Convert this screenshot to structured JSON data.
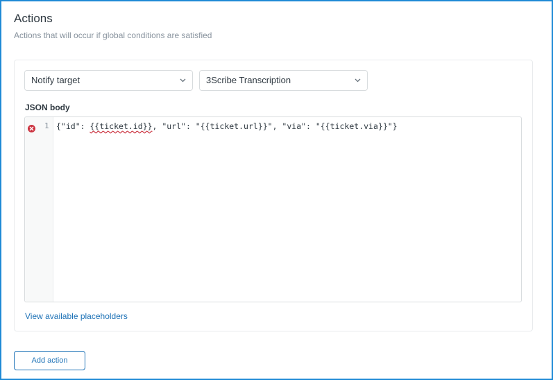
{
  "section": {
    "title": "Actions",
    "subtitle": "Actions that will occur if global conditions are satisfied"
  },
  "action": {
    "type_select": {
      "value": "Notify target",
      "icon": "chevron-down-icon"
    },
    "target_select": {
      "value": "3Scribe Transcription",
      "icon": "chevron-down-icon"
    },
    "json_body": {
      "label": "JSON body",
      "lines": [
        {
          "number": "1",
          "has_error": true,
          "before": "{\"id\": ",
          "error_token": "{{ticket.id}}",
          "after": ", \"url\": \"{{ticket.url}}\", \"via\": \"{{ticket.via}}\"}"
        }
      ],
      "error_icon": "error-circle-icon",
      "error_color": "#cc3340"
    },
    "placeholders_link": "View available placeholders"
  },
  "add_action_button": "Add action",
  "colors": {
    "accent": "#1f73b7",
    "frame_border": "#1f8ad6",
    "muted_text": "#87929d"
  }
}
